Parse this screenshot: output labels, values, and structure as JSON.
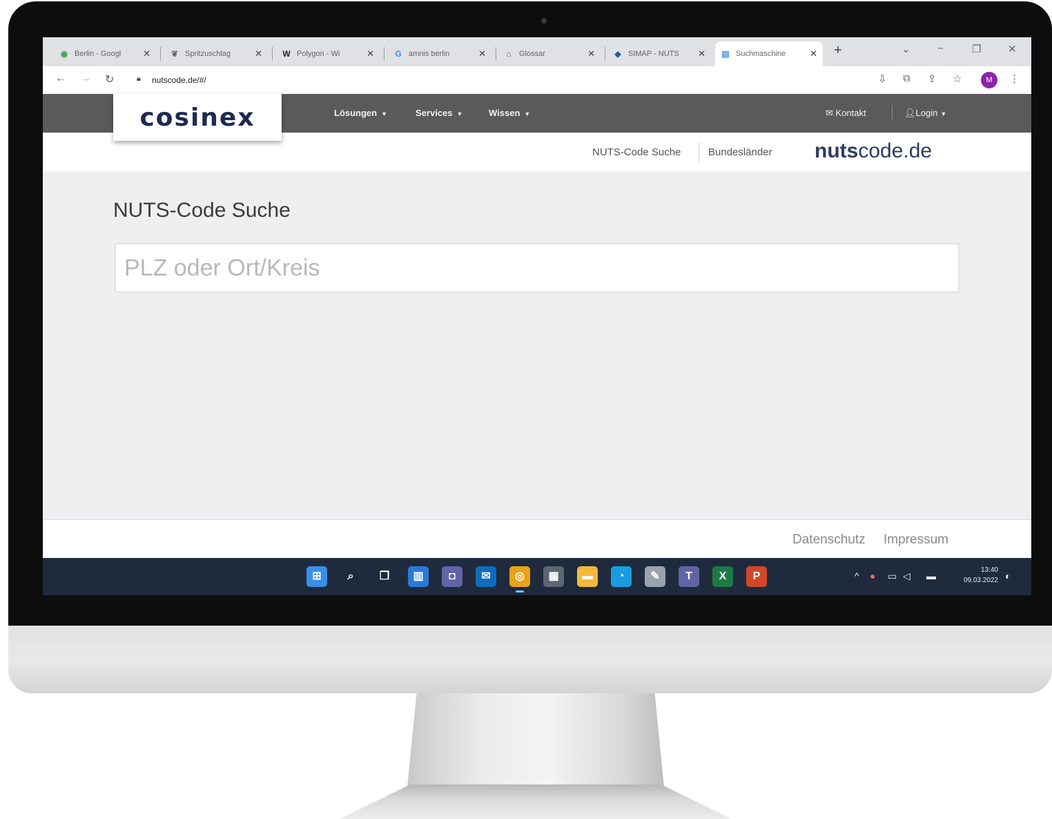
{
  "browser": {
    "tabs": [
      {
        "label": "Berlin - Googl",
        "icon": "maps-pin-icon",
        "glyph": "◉",
        "color": "#34a853"
      },
      {
        "label": "Spritzuschlag",
        "icon": "leaf-icon",
        "glyph": "❦",
        "color": "#5f6368"
      },
      {
        "label": "Polygon - Wi",
        "icon": "wikipedia-icon",
        "glyph": "W",
        "color": "#202124"
      },
      {
        "label": "amnis berlin",
        "icon": "google-icon",
        "glyph": "G",
        "color": "#4285f4"
      },
      {
        "label": "Glossar",
        "icon": "glossary-icon",
        "glyph": "⌂",
        "color": "#5f6368"
      },
      {
        "label": "SIMAP - NUTS",
        "icon": "simap-icon",
        "glyph": "◆",
        "color": "#1f5f99"
      },
      {
        "label": "Suchmaschine",
        "icon": "page-icon",
        "glyph": "▤",
        "color": "#4a90e2"
      }
    ],
    "new_tab": "+",
    "url": "nutscode.de/#/",
    "profile_initial": "M"
  },
  "site": {
    "logo": "cosinex",
    "menu": [
      {
        "label": "Lösungen"
      },
      {
        "label": "Services"
      },
      {
        "label": "Wissen"
      }
    ],
    "contact_label": "Kontakt",
    "login_label": "Login",
    "subnav": [
      {
        "label": "NUTS-Code Suche"
      },
      {
        "label": "Bundesländer"
      }
    ],
    "brand_bold": "nuts",
    "brand_rest": "code.de",
    "page_title": "NUTS-Code Suche",
    "search_placeholder": "PLZ oder Ort/Kreis",
    "search_value": "",
    "footer": {
      "privacy": "Datenschutz",
      "imprint": "Impressum"
    }
  },
  "taskbar": {
    "apps": [
      {
        "name": "start-button",
        "glyph": "⊞",
        "color": "#3a8ee6"
      },
      {
        "name": "search-icon",
        "glyph": "⌕",
        "color": "transparent"
      },
      {
        "name": "task-view-icon",
        "glyph": "❐",
        "color": "transparent"
      },
      {
        "name": "widgets-icon",
        "glyph": "▥",
        "color": "#2b79d6"
      },
      {
        "name": "teams-chat-icon",
        "glyph": "◘",
        "color": "#6264a7"
      },
      {
        "name": "outlook-icon",
        "glyph": "✉",
        "color": "#0f6cbd"
      },
      {
        "name": "chrome-icon",
        "glyph": "◎",
        "color": "#e8a317"
      },
      {
        "name": "calendar-icon",
        "glyph": "▦",
        "color": "#5c6670"
      },
      {
        "name": "file-explorer-icon",
        "glyph": "▬",
        "color": "#f2b93b"
      },
      {
        "name": "edge-icon",
        "glyph": "◔",
        "color": "#1a9be0"
      },
      {
        "name": "notepad-icon",
        "glyph": "✎",
        "color": "#9aa3ad"
      },
      {
        "name": "teams-icon",
        "glyph": "T",
        "color": "#6264a7"
      },
      {
        "name": "excel-icon",
        "glyph": "X",
        "color": "#1d7a45"
      },
      {
        "name": "powerpoint-icon",
        "glyph": "P",
        "color": "#d24726"
      }
    ],
    "time": "13:40",
    "date": "09.03.2022"
  }
}
